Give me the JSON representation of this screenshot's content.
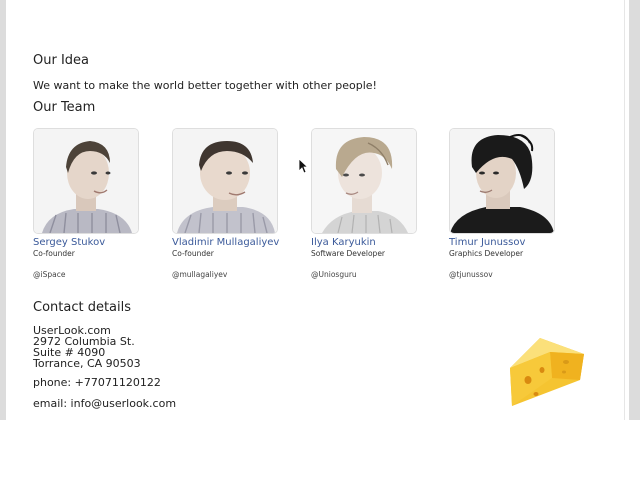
{
  "idea": {
    "heading": "Our Idea",
    "text": "We want to make the world better together with other people!"
  },
  "team": {
    "heading": "Our Team",
    "members": [
      {
        "name": "Sergey Stukov",
        "role": "Co-founder",
        "handle": "@iSpace"
      },
      {
        "name": "Vladimir Mullagaliyev",
        "role": "Co-founder",
        "handle": "@mullagaliyev"
      },
      {
        "name": "Ilya Karyukin",
        "role": "Software Developer",
        "handle": "@Uniosguru"
      },
      {
        "name": "Timur Junussov",
        "role": "Graphics Developer",
        "handle": "@tjunussov"
      }
    ]
  },
  "contact": {
    "heading": "Contact details",
    "company": "UserLook.com",
    "street": "2972 Columbia St.",
    "suite": "Suite # 4090",
    "city": "Torrance, CA 90503",
    "phone": "phone: +77071120122",
    "email": "email: info@userlook.com"
  },
  "colors": {
    "name_link": "#3b5a9a",
    "cheese": "#f5c431"
  }
}
